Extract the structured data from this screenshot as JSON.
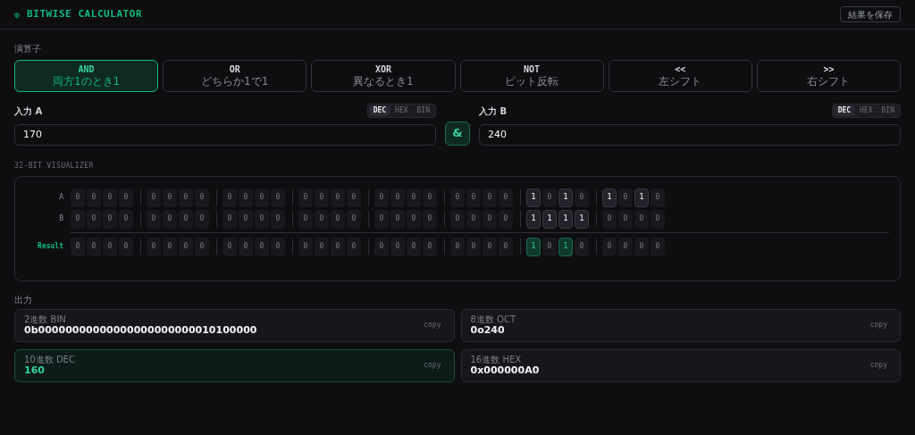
{
  "header": {
    "icon": "⊕",
    "title": "BITWISE CALCULATOR",
    "save_button": "結果を保存"
  },
  "operators": {
    "label": "演算子",
    "items": [
      {
        "symbol": "AND",
        "description": "両方1のとき1",
        "selected": true
      },
      {
        "symbol": "OR",
        "description": "どちらか1で1",
        "selected": false
      },
      {
        "symbol": "XOR",
        "description": "異なるとき1",
        "selected": false
      },
      {
        "symbol": "NOT",
        "description": "ビット反転",
        "selected": false
      },
      {
        "symbol": "<<",
        "description": "左シフト",
        "selected": false
      },
      {
        "symbol": ">>",
        "description": "右シフト",
        "selected": false
      }
    ]
  },
  "inputs": [
    {
      "label": "入力 A",
      "value": "170",
      "formats": [
        {
          "label": "DEC",
          "selected": true
        },
        {
          "label": "HEX",
          "selected": false
        },
        {
          "label": "BIN",
          "selected": false
        }
      ]
    },
    {
      "label": "入力 B",
      "value": "240",
      "formats": [
        {
          "label": "DEC",
          "selected": true
        },
        {
          "label": "HEX",
          "selected": false
        },
        {
          "label": "BIN",
          "selected": false
        }
      ]
    }
  ],
  "operator_symbol": "&",
  "visualizer": {
    "label": "32-BIT VISUALIZER",
    "rows": [
      {
        "kind": "operand",
        "label": "A",
        "bits": [
          "0",
          "0",
          "0",
          "0",
          "0",
          "0",
          "0",
          "0",
          "0",
          "0",
          "0",
          "0",
          "0",
          "0",
          "0",
          "0",
          "0",
          "0",
          "0",
          "0",
          "0",
          "0",
          "0",
          "0",
          "1",
          "0",
          "1",
          "0",
          "1",
          "0",
          "1",
          "0"
        ]
      },
      {
        "kind": "operand",
        "label": "B",
        "bits": [
          "0",
          "0",
          "0",
          "0",
          "0",
          "0",
          "0",
          "0",
          "0",
          "0",
          "0",
          "0",
          "0",
          "0",
          "0",
          "0",
          "0",
          "0",
          "0",
          "0",
          "0",
          "0",
          "0",
          "0",
          "1",
          "1",
          "1",
          "1",
          "0",
          "0",
          "0",
          "0"
        ]
      },
      {
        "kind": "result",
        "label": "Result",
        "bits": [
          "0",
          "0",
          "0",
          "0",
          "0",
          "0",
          "0",
          "0",
          "0",
          "0",
          "0",
          "0",
          "0",
          "0",
          "0",
          "0",
          "0",
          "0",
          "0",
          "0",
          "0",
          "0",
          "0",
          "0",
          "1",
          "0",
          "1",
          "0",
          "0",
          "0",
          "0",
          "0"
        ]
      }
    ]
  },
  "output": {
    "label": "出力",
    "cards": [
      {
        "label": "2進数 BIN",
        "value": "0b00000000000000000000000010100000",
        "action": "copy",
        "selected": false
      },
      {
        "label": "8進数 OCT",
        "value": "0o240",
        "action": "copy",
        "selected": false
      },
      {
        "label": "10進数 DEC",
        "value": "160",
        "action": "copy",
        "selected": true
      },
      {
        "label": "16進数 HEX",
        "value": "0x000000A0",
        "action": "copy",
        "selected": false
      }
    ]
  }
}
